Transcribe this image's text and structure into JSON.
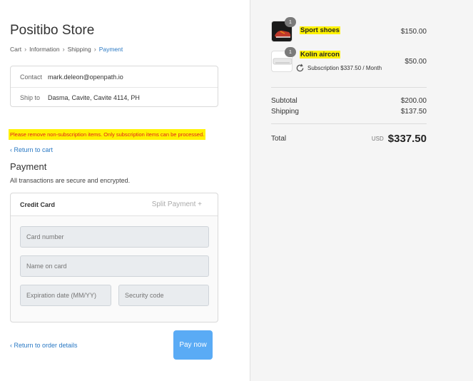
{
  "store": {
    "title": "Positibo Store"
  },
  "breadcrumb": [
    "Cart",
    "Information",
    "Shipping",
    "Payment"
  ],
  "contact": {
    "label": "Contact",
    "value": "mark.deleon@openpath.io"
  },
  "ship_to": {
    "label": "Ship to",
    "value": "Dasma, Cavite, Cavite 4114, PH"
  },
  "warning": "Please remove non-subscription items. Only subscription items can be processed.",
  "return_cart": "Return to cart",
  "payment": {
    "heading": "Payment",
    "subtitle": "All transactions are secure and encrypted.",
    "method": "Credit Card",
    "split": "Split Payment +",
    "fields": {
      "card_number": "Card number",
      "name_on_card": "Name on card",
      "expiration": "Expiration date (MM/YY)",
      "security": "Security code"
    }
  },
  "return_order": "Return to order details",
  "pay_now": "Pay now",
  "items": [
    {
      "name": "Sport shoes",
      "qty": "1",
      "price": "$150.00"
    },
    {
      "name": "Kolin aircon",
      "qty": "1",
      "price": "$50.00",
      "note": "Subscription $337.50 / Month"
    }
  ],
  "summary": {
    "subtotal_label": "Subtotal",
    "subtotal": "$200.00",
    "shipping_label": "Shipping",
    "shipping": "$137.50",
    "total_label": "Total",
    "currency": "USD",
    "total": "$337.50"
  },
  "colors": {
    "accent": "#2a79c4",
    "button": "#5aabf5",
    "highlight": "#fff200",
    "warning_text": "#e02020"
  },
  "icons": {
    "breadcrumb_sep": "chevron-right-icon",
    "back": "chevron-left-icon",
    "subscription": "refresh-icon"
  }
}
